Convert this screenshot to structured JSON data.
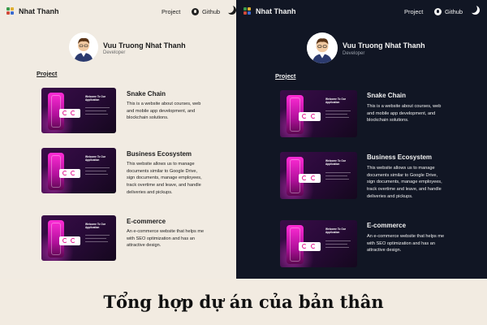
{
  "light_panel": {
    "nav": {
      "brand": "Nhat Thanh",
      "project_link": "Project",
      "github_link": "Github"
    },
    "profile": {
      "name": "Vuu Truong Nhat Thanh",
      "role": "Developer"
    },
    "section_title": "Project",
    "projects": [
      {
        "title": "Snake Chain",
        "description": "This is a website about courses, web and mobile app development, and blockchain solutions.",
        "thumb_text": "Welcome To Our Application"
      },
      {
        "title": "Business Ecosystem",
        "description": "This website allows us to manage documents similar to Google Drive, sign documents, manage employees, track overtime and leave, and handle deliveries and pickups.",
        "thumb_text": "Welcome To Our Application"
      },
      {
        "title": "E-commerce",
        "description": "An e-commerce website that helps me with SEO optimization and has an attractive design.",
        "thumb_text": "Welcome To Our Application"
      }
    ]
  },
  "dark_panel": {
    "nav": {
      "brand": "Nhat Thanh",
      "project_link": "Project",
      "github_link": "Github"
    },
    "profile": {
      "name": "Vuu Truong Nhat Thanh",
      "role": "Developer"
    },
    "section_title": "Project",
    "projects": [
      {
        "title": "Snake Chain",
        "description": "This is a website about courses, web and mobile app development, and blockchain solutions.",
        "thumb_text": "Welcome To Our Application"
      },
      {
        "title": "Business Ecosystem",
        "description": "This website allows us to manage documents similar to Google Drive, sign documents, manage employees, track overtime and leave, and handle deliveries and pickups.",
        "thumb_text": "Welcome To Our Application"
      },
      {
        "title": "E-commerce",
        "description": "An e-commerce website that helps me with SEO optimization and has an attractive design.",
        "thumb_text": "Welcome To Our Application"
      }
    ]
  },
  "caption": "Tổng hợp dự án của bản thân",
  "icons": {
    "brand": "logo-blocks-icon",
    "github": "github-icon",
    "theme": "moon-icon"
  },
  "colors": {
    "light_bg": "#f1ebe2",
    "dark_bg": "#111624",
    "accent": "#e3148f",
    "thumb_bg": "#2a0a3a"
  }
}
